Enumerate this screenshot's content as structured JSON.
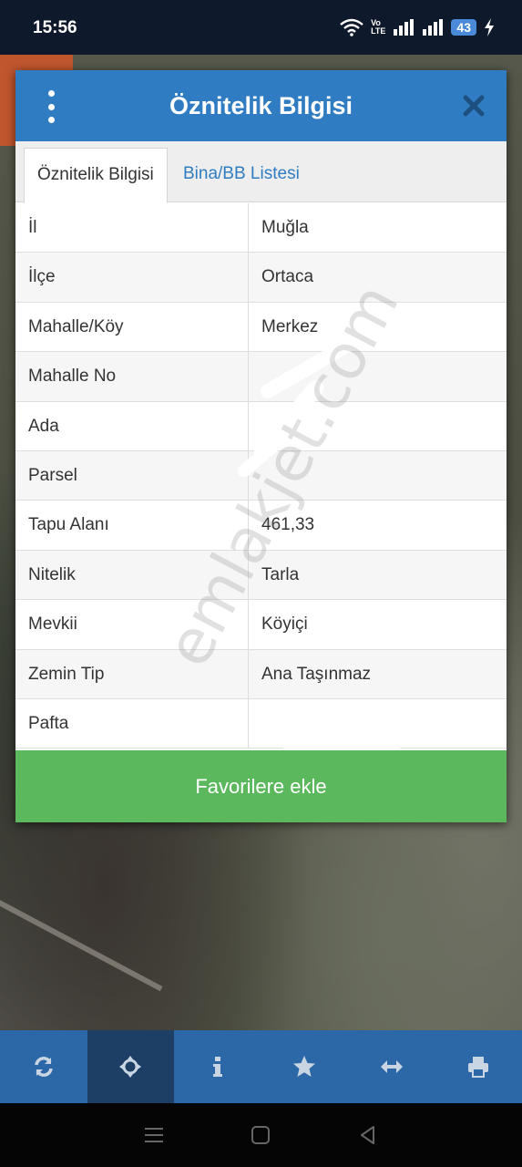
{
  "status_bar": {
    "time": "15:56",
    "network_label_top": "Vo",
    "network_label_bottom": "LTE",
    "battery": "43"
  },
  "dialog": {
    "title": "Öznitelik Bilgisi",
    "tabs": [
      {
        "label": "Öznitelik Bilgisi",
        "active": true
      },
      {
        "label": "Bina/BB Listesi",
        "active": false
      }
    ],
    "rows": [
      {
        "label": "İl",
        "value": "Muğla"
      },
      {
        "label": "İlçe",
        "value": "Ortaca"
      },
      {
        "label": "Mahalle/Köy",
        "value": "Merkez"
      },
      {
        "label": "Mahalle No",
        "value": ""
      },
      {
        "label": "Ada",
        "value": ""
      },
      {
        "label": "Parsel",
        "value": ""
      },
      {
        "label": "Tapu Alanı",
        "value": "461,33"
      },
      {
        "label": "Nitelik",
        "value": "Tarla"
      },
      {
        "label": "Mevkii",
        "value": "Köyiçi"
      },
      {
        "label": "Zemin Tip",
        "value": "Ana Taşınmaz"
      },
      {
        "label": "Pafta",
        "value": ""
      }
    ],
    "favorite_button": "Favorilere ekle",
    "watermark": "emlakjet.com"
  },
  "toolbar": {
    "icons": [
      "refresh-icon",
      "move-icon",
      "info-icon",
      "star-icon",
      "resize-horizontal-icon",
      "print-icon"
    ]
  },
  "colors": {
    "header": "#2f7cc2",
    "favorite": "#5cb85c",
    "toolbar": "#2c68a7",
    "toolbar_active": "#1d3f66"
  }
}
